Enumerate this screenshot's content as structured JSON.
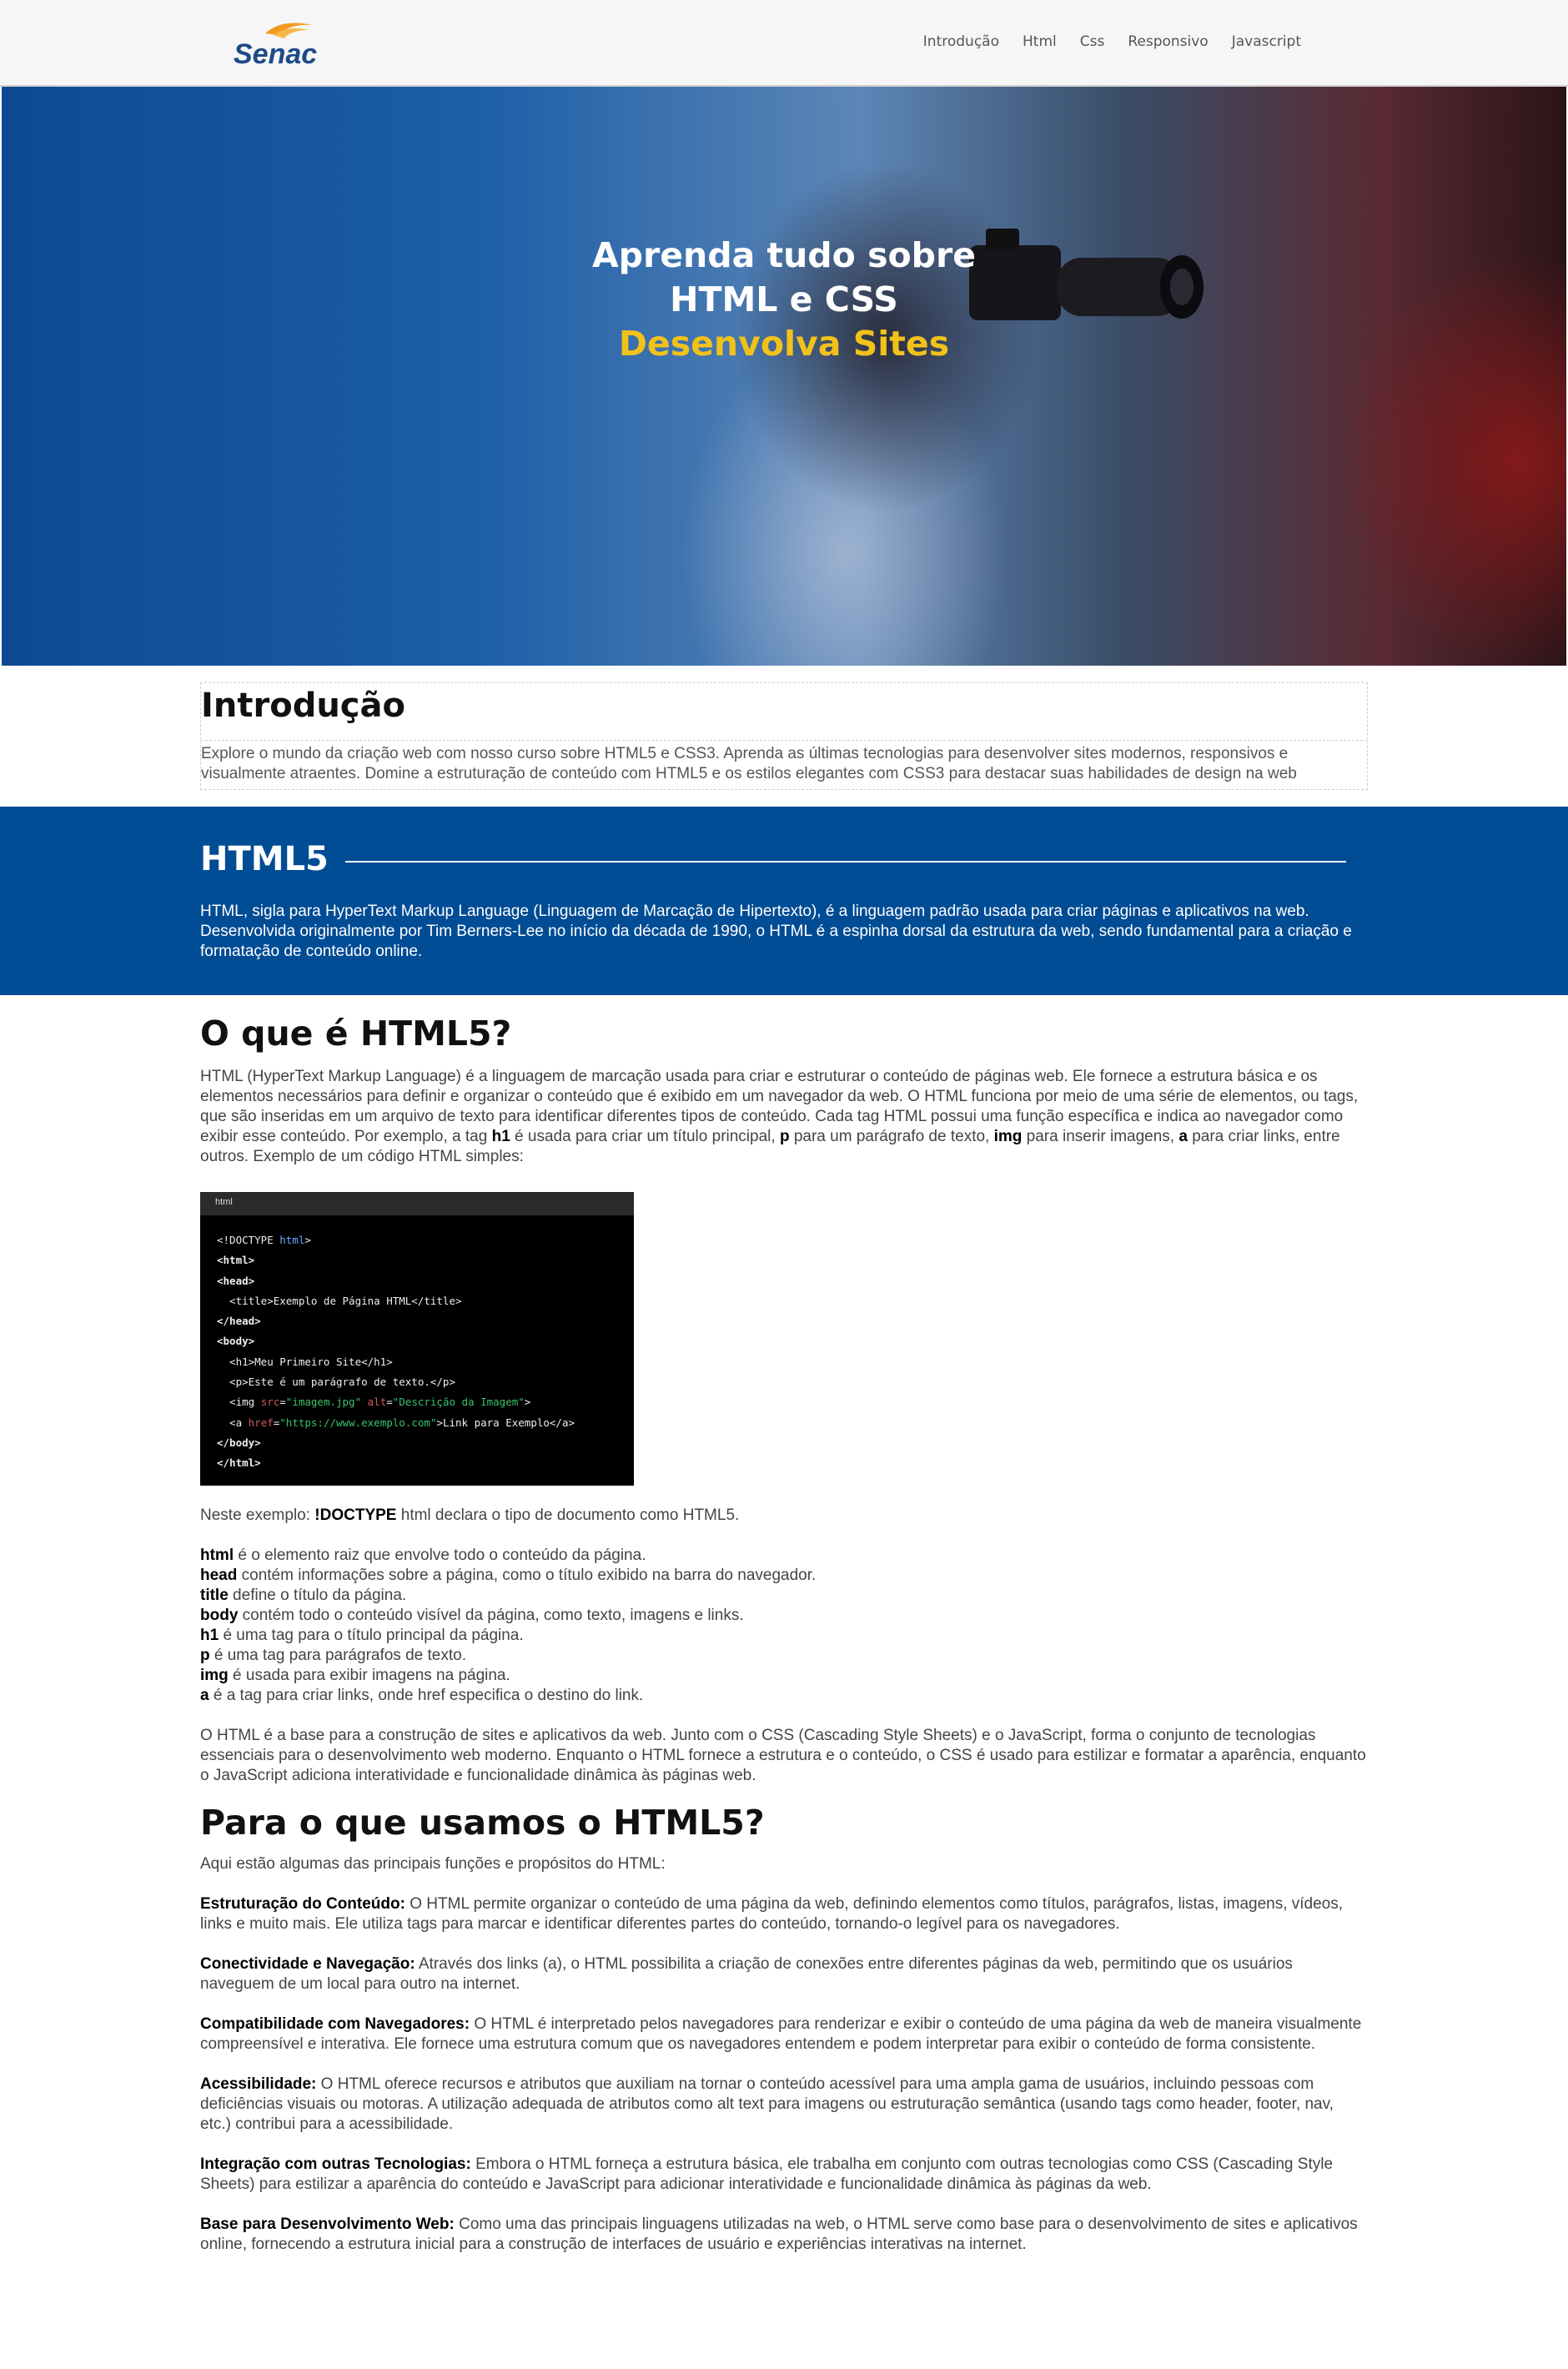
{
  "header": {
    "logo_text": "Senac",
    "nav": [
      "Introdução",
      "Html",
      "Css",
      "Responsivo",
      "Javascript"
    ]
  },
  "hero": {
    "line1": "Aprenda tudo sobre",
    "line2": "HTML e CSS",
    "line3": "Desenvolva Sites"
  },
  "intro": {
    "title": "Introdução",
    "text": "Explore o mundo da criação web com nosso curso sobre HTML5 e CSS3. Aprenda as últimas tecnologias para desenvolver sites modernos, responsivos e visualmente atraentes. Domine a estruturação de conteúdo com HTML5 e os estilos elegantes com CSS3 para destacar suas habilidades de design na web"
  },
  "html5_band": {
    "title": "HTML5",
    "text": "HTML, sigla para HyperText Markup Language (Linguagem de Marcação de Hipertexto), é a linguagem padrão usada para criar páginas e aplicativos na web. Desenvolvida originalmente por Tim Berners-Lee no início da década de 1990, o HTML é a espinha dorsal da estrutura da web, sendo fundamental para a criação e formatação de conteúdo online."
  },
  "what_is": {
    "title": "O que é HTML5?",
    "p1_a": "HTML (HyperText Markup Language) é a linguagem de marcação usada para criar e estruturar o conteúdo de páginas web. Ele fornece a estrutura básica e os elementos necessários para definir e organizar o conteúdo que é exibido em um navegador da web. O HTML funciona por meio de uma série de elementos, ou tags, que são inseridas em um arquivo de texto para identificar diferentes tipos de conteúdo. Cada tag HTML possui uma função específica e indica ao navegador como exibir esse conteúdo. Por exemplo, a tag ",
    "p1_h1": "h1",
    "p1_b": " é usada para criar um título principal, ",
    "p1_p": "p",
    "p1_c": " para um parágrafo de texto, ",
    "p1_img": "img",
    "p1_d": " para inserir imagens, ",
    "p1_a_tag": "a",
    "p1_e": " para criar links, entre outros. Exemplo de um código HTML simples:",
    "code_label": "html",
    "example_intro": "Neste exemplo: ",
    "example_doctype": "!DOCTYPE",
    "example_rest": " html declara o tipo de documento como HTML5.",
    "definitions": [
      {
        "tag": "html",
        "desc": " é o elemento raiz que envolve todo o conteúdo da página."
      },
      {
        "tag": "head",
        "desc": " contém informações sobre a página, como o título exibido na barra do navegador."
      },
      {
        "tag": "title",
        "desc": " define o título da página."
      },
      {
        "tag": "body",
        "desc": " contém todo o conteúdo visível da página, como texto, imagens e links."
      },
      {
        "tag": "h1",
        "desc": " é uma tag para o título principal da página."
      },
      {
        "tag": "p",
        "desc": " é uma tag para parágrafos de texto."
      },
      {
        "tag": "img",
        "desc": " é usada para exibir imagens na página."
      },
      {
        "tag": "a",
        "desc": " é a tag para criar links, onde href especifica o destino do link."
      }
    ],
    "closing": "O HTML é a base para a construção de sites e aplicativos da web. Junto com o CSS (Cascading Style Sheets) e o JavaScript, forma o conjunto de tecnologias essenciais para o desenvolvimento web moderno. Enquanto o HTML fornece a estrutura e o conteúdo, o CSS é usado para estilizar e formatar a aparência, enquanto o JavaScript adiciona interatividade e funcionalidade dinâmica às páginas web."
  },
  "uses": {
    "title": "Para o que usamos o HTML5?",
    "intro": "Aqui estão algumas das principais funções e propósitos do HTML:",
    "items": [
      {
        "label": "Estruturação do Conteúdo:",
        "text": " O HTML permite organizar o conteúdo de uma página da web, definindo elementos como títulos, parágrafos, listas, imagens, vídeos, links e muito mais. Ele utiliza tags para marcar e identificar diferentes partes do conteúdo, tornando-o legível para os navegadores."
      },
      {
        "label": "Conectividade e Navegação:",
        "text": " Através dos links (a), o HTML possibilita a criação de conexões entre diferentes páginas da web, permitindo que os usuários naveguem de um local para outro na internet."
      },
      {
        "label": "Compatibilidade com Navegadores:",
        "text": " O HTML é interpretado pelos navegadores para renderizar e exibir o conteúdo de uma página da web de maneira visualmente compreensível e interativa. Ele fornece uma estrutura comum que os navegadores entendem e podem interpretar para exibir o conteúdo de forma consistente."
      },
      {
        "label": "Acessibilidade:",
        "text": " O HTML oferece recursos e atributos que auxiliam na tornar o conteúdo acessível para uma ampla gama de usuários, incluindo pessoas com deficiências visuais ou motoras. A utilização adequada de atributos como alt text para imagens ou estruturação semântica (usando tags como header, footer, nav, etc.) contribui para a acessibilidade."
      },
      {
        "label": "Integração com outras Tecnologias:",
        "text": " Embora o HTML forneça a estrutura básica, ele trabalha em conjunto com outras tecnologias como CSS (Cascading Style Sheets) para estilizar a aparência do conteúdo e JavaScript para adicionar interatividade e funcionalidade dinâmica às páginas da web."
      },
      {
        "label": "Base para Desenvolvimento Web:",
        "text": " Como uma das principais linguagens utilizadas na web, o HTML serve como base para o desenvolvimento de sites e aplicativos online, fornecendo a estrutura inicial para a construção de interfaces de usuário e experiências interativas na internet."
      }
    ]
  },
  "colors": {
    "brand_blue": "#004c95",
    "accent_yellow": "#f2c21a",
    "logo_orange": "#f39a1f"
  }
}
